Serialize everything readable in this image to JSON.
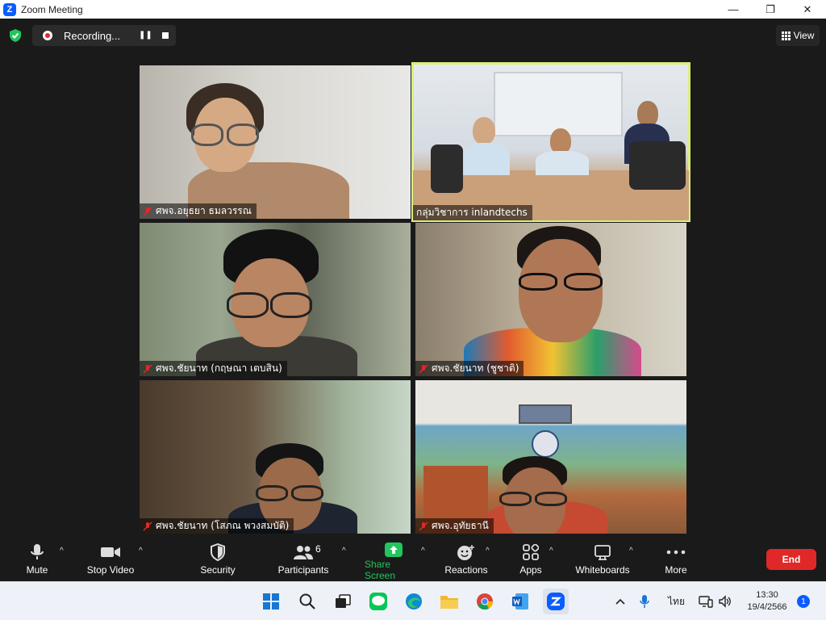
{
  "window": {
    "title": "Zoom Meeting",
    "minimize": "—",
    "maximize": "❐",
    "close": "✕"
  },
  "topbar": {
    "recording_label": "Recording...",
    "pause_icon": "❚❚",
    "view_label": "View"
  },
  "participants": [
    {
      "name": "ศพจ.อยุธยา ธมลวรรณ"
    },
    {
      "name": "กลุ่มวิชาการ inlandtechs"
    },
    {
      "name": "ศพจ.ชัยนาท (กฤษณา เตบสิน)"
    },
    {
      "name": "ศพจ.ชัยนาท (ชูชาติ)"
    },
    {
      "name": "ศพจ.ชัยนาท (โสภณ พวงสมบัติ)"
    },
    {
      "name": "ศพจ.อุทัยธานี"
    }
  ],
  "toolbar": {
    "mute": "Mute",
    "stop_video": "Stop Video",
    "security": "Security",
    "participants": "Participants",
    "participants_count": "6",
    "share_screen": "Share Screen",
    "reactions": "Reactions",
    "apps": "Apps",
    "whiteboards": "Whiteboards",
    "more": "More",
    "end": "End"
  },
  "taskbar": {
    "lang": "ไทย",
    "time": "13:30",
    "date": "19/4/2566",
    "notifications": "1"
  },
  "colors": {
    "accent": "#0b5cff",
    "end": "#e02828",
    "share": "#22c55e",
    "active_speaker": "#d9f07a"
  },
  "icons": [
    "shield-icon",
    "record-icon",
    "grid-icon",
    "mic-off-icon",
    "mic-icon",
    "camera-icon",
    "shield-lock-icon",
    "people-icon",
    "share-arrow-icon",
    "emoji-icon",
    "apps-icon",
    "whiteboard-icon",
    "more-dots-icon",
    "windows-icon",
    "search-icon",
    "line-icon",
    "edge-icon",
    "folder-icon",
    "chrome-icon",
    "word-icon",
    "zoom-icon"
  ]
}
